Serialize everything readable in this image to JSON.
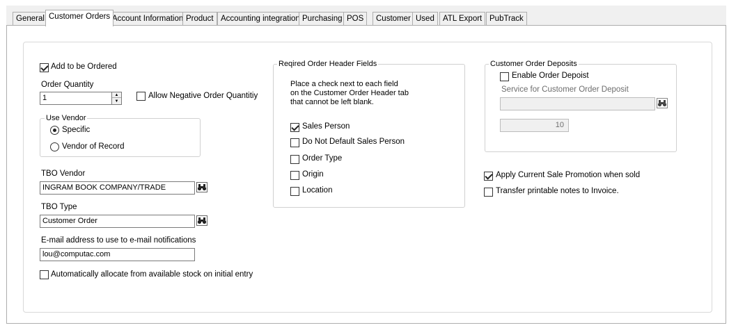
{
  "tabs": [
    "General",
    "Customer Orders",
    "Account Information",
    "Product",
    "Accounting integration",
    "Purchasing",
    "POS",
    "Customer",
    "Used",
    "ATL Export",
    "PubTrack"
  ],
  "active_tab": "Customer Orders",
  "left": {
    "add_to_be_ordered": "Add to be Ordered",
    "order_quantity_label": "Order Quantity",
    "order_quantity_value": "1",
    "allow_negative": "Allow Negative Order Quantitiy",
    "use_vendor_title": "Use Vendor",
    "specific": "Specific",
    "vendor_of_record": "Vendor of Record",
    "tbo_vendor_label": "TBO Vendor",
    "tbo_vendor_value": "INGRAM BOOK COMPANY/TRADE",
    "tbo_type_label": "TBO Type",
    "tbo_type_value": "Customer Order",
    "email_label": "E-mail address to use to e-mail  notifications",
    "email_value": "lou@computac.com",
    "auto_allocate": "Automatically allocate from available stock on initial entry"
  },
  "middle": {
    "title": "Reqired Order Header Fields",
    "instructions": [
      "Place a check next to each field",
      "on the Customer Order Header tab",
      "that cannot be left blank."
    ],
    "sales_person": "Sales Person",
    "do_not_default": "Do Not Default Sales Person",
    "order_type": "Order Type",
    "origin": "Origin",
    "location": "Location"
  },
  "right": {
    "deposits_title": "Customer Order Deposits",
    "enable_deposit": "Enable Order Depoist",
    "service_label": "Service for Customer Order Deposit",
    "service_value": "",
    "deposit_amount": "10",
    "apply_promotion": "Apply Current Sale Promotion when sold",
    "transfer_notes": "Transfer printable notes to Invoice."
  }
}
